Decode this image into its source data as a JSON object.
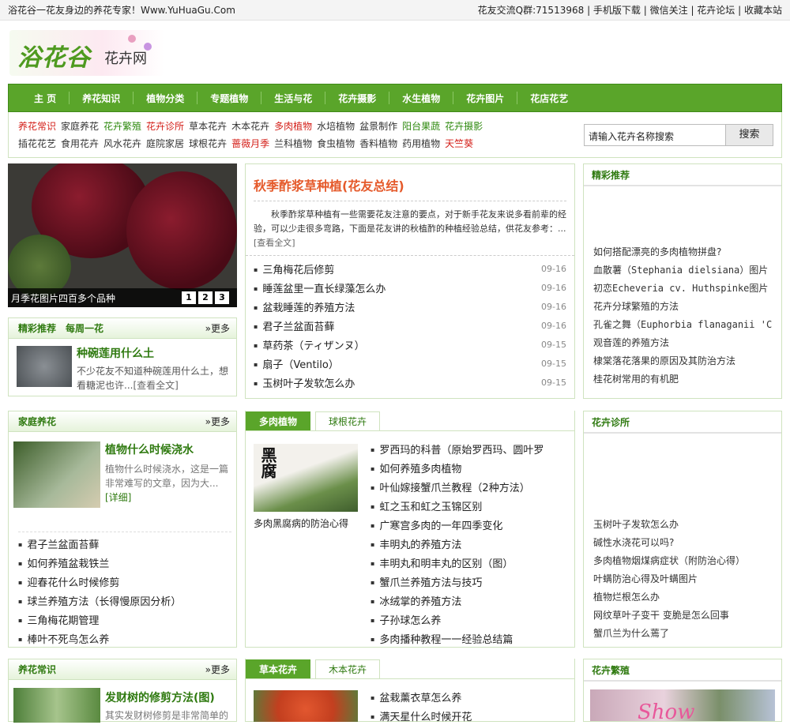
{
  "topbar": {
    "slogan": "浴花谷一花友身边的养花专家！Www.YuHuaGu.Com",
    "links": [
      "花友交流Q群:71513968",
      "手机版下载",
      "微信关注",
      "花卉论坛",
      "收藏本站"
    ]
  },
  "logo": {
    "brand": "浴花谷",
    "sub": "花卉网"
  },
  "nav": [
    "主 页",
    "养花知识",
    "植物分类",
    "专题植物",
    "生活与花",
    "花卉摄影",
    "水生植物",
    "花卉图片",
    "花店花艺"
  ],
  "categories": {
    "row1": [
      {
        "t": "养花常识",
        "c": "#d4201a"
      },
      {
        "t": "家庭养花",
        "c": "#333333"
      },
      {
        "t": "花卉繁殖",
        "c": "#2f8a10"
      },
      {
        "t": "花卉诊所",
        "c": "#d4201a"
      },
      {
        "t": "草本花卉",
        "c": "#333333"
      },
      {
        "t": "木本花卉",
        "c": "#333333"
      },
      {
        "t": "多肉植物",
        "c": "#d4201a"
      },
      {
        "t": "水培植物",
        "c": "#333333"
      },
      {
        "t": "盆景制作",
        "c": "#333333"
      },
      {
        "t": "阳台果蔬",
        "c": "#2f8a10"
      },
      {
        "t": "花卉摄影",
        "c": "#2f8a10"
      }
    ],
    "row2": [
      {
        "t": "插花花艺",
        "c": "#333333"
      },
      {
        "t": "食用花卉",
        "c": "#333333"
      },
      {
        "t": "风水花卉",
        "c": "#333333"
      },
      {
        "t": "庭院家居",
        "c": "#333333"
      },
      {
        "t": "球根花卉",
        "c": "#333333"
      },
      {
        "t": "蔷薇月季",
        "c": "#d4201a"
      },
      {
        "t": "兰科植物",
        "c": "#333333"
      },
      {
        "t": "食虫植物",
        "c": "#333333"
      },
      {
        "t": "香料植物",
        "c": "#333333"
      },
      {
        "t": "药用植物",
        "c": "#333333"
      },
      {
        "t": "天竺葵",
        "c": "#d4201a"
      }
    ]
  },
  "search": {
    "value": "请输入花卉名称搜索",
    "button": "搜索"
  },
  "slider": {
    "caption": "月季花图片四百多个品种",
    "pages": [
      "1",
      "2",
      "3"
    ]
  },
  "weekly": {
    "title": "精彩推荐　每周一花",
    "more": "»更多",
    "item_title": "种碗莲用什么土",
    "item_text": "不少花友不知道种碗莲用什么土，想看糖泥也许...",
    "item_link": "[查看全文]"
  },
  "headline": {
    "title": "秋季酢浆草种植(花友总结)",
    "intro": "秋季酢浆草种植有一些需要花友注意的要点，对于新手花友来说多看前辈的经验，可以少走很多弯路，下面是花友讲的秋植酢的种植经验总结，供花友参考：...",
    "link": "[查看全文]",
    "news": [
      {
        "t": "三角梅花后修剪",
        "d": "09-16"
      },
      {
        "t": "睡莲盆里一直长绿藻怎么办",
        "d": "09-16"
      },
      {
        "t": "盆栽睡莲的养殖方法",
        "d": "09-16"
      },
      {
        "t": "君子兰盆面苔藓",
        "d": "09-16"
      },
      {
        "t": "草药茶（ティザンヌ）",
        "d": "09-15"
      },
      {
        "t": "扇子（Ventilo）",
        "d": "09-15"
      },
      {
        "t": "玉树叶子发软怎么办",
        "d": "09-15"
      }
    ]
  },
  "featured": {
    "title": "精彩推荐",
    "items": [
      "如何搭配漂亮的多肉植物拼盘?",
      "血散薯（Stephania dielsiana）图片",
      "初恋Echeveria cv. Huthspinke图片",
      "花卉分球繁殖的方法",
      "孔雀之舞（Euphorbia flanaganii 'Cris",
      "观音莲的养殖方法",
      "棣棠落花落果的原因及其防治方法",
      "桂花树常用的有机肥"
    ]
  },
  "family": {
    "title": "家庭养花",
    "more": "»更多",
    "item_title": "植物什么时候浇水",
    "item_text": "植物什么时候浇水，这是一篇非常难写的文章，因为大...",
    "item_link": "[详细]",
    "list": [
      "君子兰盆面苔藓",
      "如何养殖盆栽铁兰",
      "迎春花什么时候修剪",
      "球兰养殖方法（长得慢原因分析）",
      "三角梅花期管理",
      "棒叶不死鸟怎么养"
    ]
  },
  "succulent": {
    "tabs": [
      "多肉植物",
      "球根花卉"
    ],
    "img_text": "黑腐",
    "caption": "多肉黑腐病的防治心得",
    "list": [
      "罗西玛的科普（原始罗西玛、圆叶罗",
      "如何养殖多肉植物",
      "叶仙嫁接蟹爪兰教程（2种方法）",
      "虹之玉和虹之玉锦区别",
      "广寒宫多肉的一年四季变化",
      "丰明丸的养殖方法",
      "丰明丸和明丰丸的区别（图）",
      "蟹爪兰养殖方法与技巧",
      "冰绒掌的养殖方法",
      "子孙球怎么养",
      "多肉播种教程一一经验总结篇"
    ]
  },
  "clinic": {
    "title": "花卉诊所",
    "items": [
      "玉树叶子发软怎么办",
      "碱性水浇花可以吗?",
      "多肉植物烟煤病症状（附防治心得）",
      "叶螨防治心得及叶螨图片",
      "植物烂根怎么办",
      "网纹草叶子变干 变脆是怎么回事",
      "蟹爪兰为什么蔫了"
    ]
  },
  "common": {
    "title": "养花常识",
    "more": "»更多",
    "item_title": "发财树的修剪方法(图)",
    "item_text": "其实发财树修剪是非常简单的"
  },
  "herb": {
    "tabs": [
      "草本花卉",
      "木本花卉"
    ],
    "list": [
      "盆栽薰衣草怎么养",
      "满天星什么时候开花"
    ]
  },
  "propagate": {
    "title": "花卉繁殖",
    "img_text": "Show"
  }
}
